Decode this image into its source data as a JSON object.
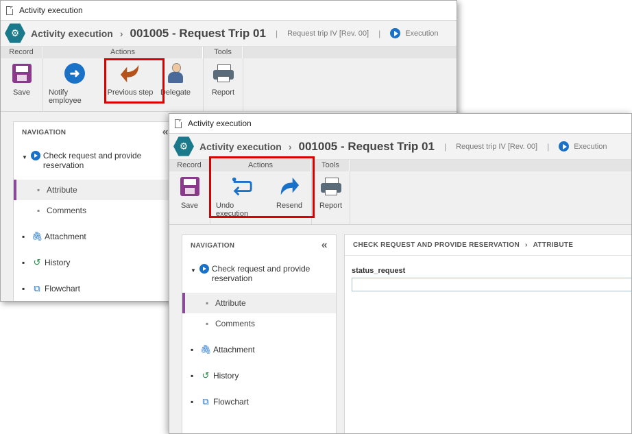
{
  "windows": {
    "back": {
      "window_title": "Activity execution",
      "header": {
        "title": "Activity execution",
        "code": "001005 - Request Trip 01",
        "revision": "Request trip IV [Rev. 00]",
        "status": "Execution"
      },
      "ribbon": {
        "groups": {
          "record": "Record",
          "actions": "Actions",
          "tools": "Tools"
        },
        "buttons": {
          "save": "Save",
          "notify": "Notify employee",
          "previous": "Previous step",
          "delegate": "Delegate",
          "report": "Report"
        }
      },
      "navigation": {
        "heading": "NAVIGATION",
        "activity": "Check request and provide reservation",
        "attribute": "Attribute",
        "comments": "Comments",
        "attachment": "Attachment",
        "history": "History",
        "flowchart": "Flowchart"
      }
    },
    "front": {
      "window_title": "Activity execution",
      "header": {
        "title": "Activity execution",
        "code": "001005 - Request Trip 01",
        "revision": "Request trip IV [Rev. 00]",
        "status": "Execution"
      },
      "ribbon": {
        "groups": {
          "record": "Record",
          "actions": "Actions",
          "tools": "Tools"
        },
        "buttons": {
          "save": "Save",
          "undo": "Undo execution",
          "resend": "Resend",
          "report": "Report"
        }
      },
      "navigation": {
        "heading": "NAVIGATION",
        "activity": "Check request and provide reservation",
        "attribute": "Attribute",
        "comments": "Comments",
        "attachment": "Attachment",
        "history": "History",
        "flowchart": "Flowchart"
      },
      "panel": {
        "crumb_activity": "CHECK REQUEST AND PROVIDE RESERVATION",
        "crumb_section": "ATTRIBUTE",
        "field_label": "status_request",
        "field_value": ""
      }
    }
  },
  "colors": {
    "brand_teal": "#1a7a8c",
    "accent_blue": "#1a72c8",
    "highlight_red": "#d90000",
    "active_purple": "#8a4a9a",
    "previous_arrow": "#b5531a"
  },
  "icons": {
    "save": "save-icon",
    "notify": "arrow-right-circle-icon",
    "previous": "return-arrow-icon",
    "delegate": "person-icon",
    "report": "printer-icon",
    "undo": "undo-icon",
    "resend": "forward-arrow-icon"
  }
}
